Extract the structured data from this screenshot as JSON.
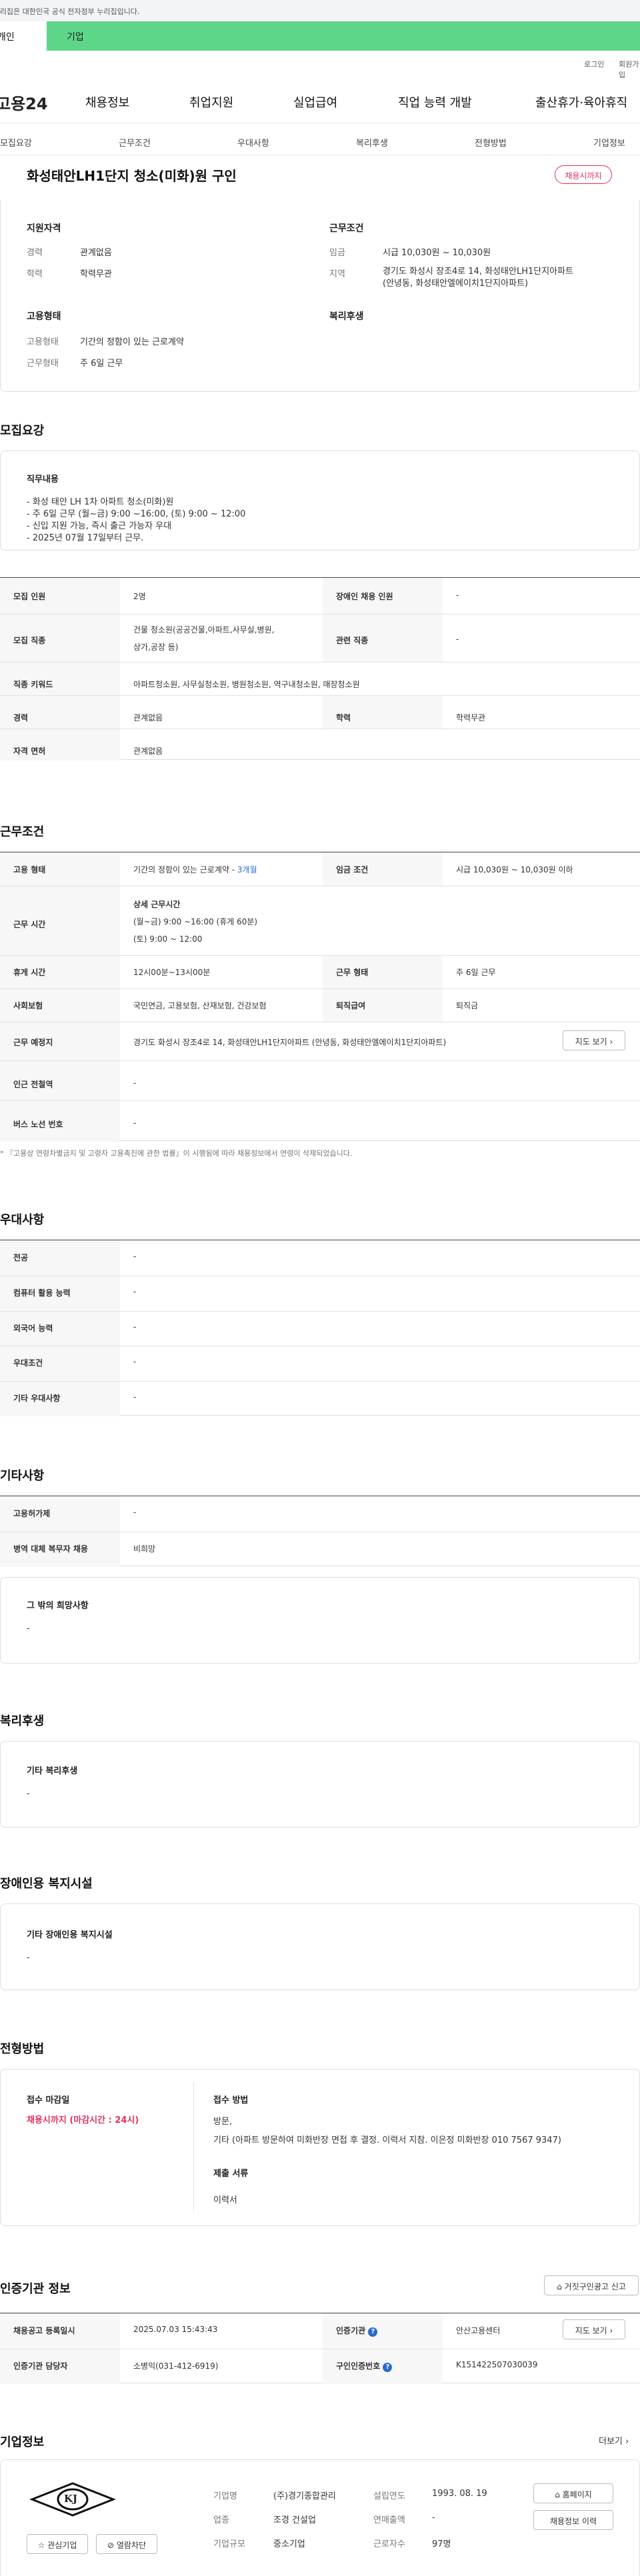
{
  "top_notice": "이 누리집은 대한민국 공식 전자정부 누리집입니다.",
  "tabs": {
    "individual": "개인",
    "company": "기업"
  },
  "util": {
    "login": "로그인",
    "join": "회원가입"
  },
  "logo": "고용24",
  "gnb": [
    "채용정보",
    "취업지원",
    "실업급여",
    "직업 능력 개발",
    "출산휴가·육아휴직"
  ],
  "anchors": [
    "모집요강",
    "근무조건",
    "우대사항",
    "복리후생",
    "전형방법",
    "기업정보"
  ],
  "job": {
    "title": "화성태안LH1단지 청소(미화)원 구인",
    "status_badge": "채용시까지",
    "summary": {
      "qual_title": "지원자격",
      "career_label": "경력",
      "career_value": "관계없음",
      "edu_label": "학력",
      "edu_value": "학력무관",
      "cond_title": "근무조건",
      "wage_label": "임금",
      "wage_value": "시급 10,030원 ~ 10,030원",
      "region_label": "지역",
      "region_value_1": "경기도 화성시 장조4로 14, 화성태안LH1단지아파트",
      "region_value_2": "(안녕동, 화성태안엘에이치1단지아파트)",
      "type_title": "고용형태",
      "emp_type_label": "고용형태",
      "emp_type_value": "기간의 정함이 있는 근로계약",
      "work_form_label": "근무형태",
      "work_form_value": "주 6일 근무",
      "welfare_title": "복리후생"
    }
  },
  "recruit": {
    "title": "모집요강",
    "duty_title": "직무내용",
    "duty_lines": [
      "- 화성 태안 LH 1차 아파트 청소(미화)원",
      "- 주 6일 근무 (월~금) 9:00 ~16:00, (토) 9:00 ~ 12:00",
      "- 신입 지원 가능, 즉시 출근 가능자 우대",
      "- 2025년 07월 17일부터 근무."
    ],
    "rows": {
      "headcount_label": "모집 인원",
      "headcount_value": "2명",
      "disabled_label": "장애인 채용 인원",
      "disabled_value": "-",
      "job_label": "모집 직종",
      "job_value_1": "건물 청소원(공공건물,아파트,사무실,병원,",
      "job_value_2": "상가,공장 등)",
      "related_label": "관련 직종",
      "related_value": "-",
      "keyword_label": "직종 키워드",
      "keyword_value": "아파트청소원, 사무실청소원, 병원청소원, 역구내청소원, 매장청소원",
      "career_label": "경력",
      "career_value": "관계없음",
      "edu_label": "학력",
      "edu_value": "학력무관",
      "license_label": "자격 면허",
      "license_value": "관계없음"
    }
  },
  "conditions": {
    "title": "근무조건",
    "emp_type_label": "고용 형태",
    "emp_type_value": "기간의 정함이 있는 근로계약 - ",
    "emp_type_period": "3개월",
    "wage_label": "임금 조건",
    "wage_value": "시급 10,030원 ~ 10,030원 이하",
    "hours_label": "근무 시간",
    "hours_title": "상세 근무시간",
    "hours_line1": "(월~금) 9:00 ~16:00 (휴게 60분)",
    "hours_line2": "(토) 9:00 ~ 12:00",
    "break_label": "휴게 시간",
    "break_value": "12시00분~13시00분",
    "form_label": "근무 형태",
    "form_value": "주 6일 근무",
    "insurance_label": "사회보험",
    "insurance_value": "국민연금, 고용보험, 산재보험, 건강보험",
    "retire_label": "퇴직급여",
    "retire_value": "퇴직금",
    "place_label": "근무 예정지",
    "place_value": "경기도 화성시 장조4로 14, 화성태안LH1단지아파트 (안녕동, 화성태안엘에이치1단지아파트)",
    "map_button": "지도 보기",
    "subway_label": "인근 전철역",
    "subway_value": "-",
    "bus_label": "버스 노선 번호",
    "bus_value": "-",
    "note": "* 『고용상 연령차별금지 및 고령자 고용촉진에 관한 법률』이 시행됨에 따라 채용정보에서 연령이 삭제되었습니다."
  },
  "preference": {
    "title": "우대사항",
    "rows": [
      [
        "전공",
        "-"
      ],
      [
        "컴퓨터 활용 능력",
        "-"
      ],
      [
        "외국어 능력",
        "-"
      ],
      [
        "우대조건",
        "-"
      ],
      [
        "기타 우대사항",
        "-"
      ]
    ]
  },
  "etc": {
    "title": "기타사항",
    "rows": [
      [
        "고용허가제",
        "-"
      ],
      [
        "병역 대체 복무자 채용",
        "비희망"
      ]
    ],
    "wish_title": "그 밖의 희망사항",
    "wish_value": "-"
  },
  "welfare": {
    "title": "복리후생",
    "sub": "기타 복리후생",
    "value": "-"
  },
  "disabled_fac": {
    "title": "장애인용 복지시설",
    "sub": "기타 장애인용 복지시설",
    "value": "-"
  },
  "selection": {
    "title": "전형방법",
    "deadline_label": "접수 마감일",
    "deadline_value": "채용시까지 (마감시간 : 24시)",
    "method_label": "접수 방법",
    "method_1": "방문,",
    "method_2": "기타 (아파트 방문하여 미화반장 면접 후 결정. 이력서 지참. 이은정 미화반장 010 7567 9347)",
    "docs_label": "제출 서류",
    "docs_value": "이력서"
  },
  "cert": {
    "title": "인증기관 정보",
    "report_button": "거짓구인광고 신고",
    "reg_label": "채용공고 등록일시",
    "reg_value": "2025.07.03 15:43:43",
    "agency_label": "인증기관",
    "agency_value": "안산고용센터",
    "map_button": "지도 보기",
    "manager_label": "인증기관 담당자",
    "manager_value": "소병익(031-412-6919)",
    "number_label": "구인인증번호",
    "number_value": "K151422507030039"
  },
  "company": {
    "title": "기업정보",
    "more": "더보기",
    "logo_text": "KJ",
    "name_label": "기업명",
    "name_value": "(주)경기종합관리",
    "year_label": "설립연도",
    "year_value": "1993. 08. 19",
    "industry_label": "업종",
    "industry_value": "조경 건설업",
    "sales_label": "연매출액",
    "sales_value": "-",
    "scale_label": "기업규모",
    "scale_value": "중소기업",
    "employees_label": "근로자수",
    "employees_value": "97명",
    "homepage_button": "홈페이지",
    "jobs_button": "채용정보 이력",
    "fav_button": "관심기업",
    "block_button": "열람차단"
  }
}
